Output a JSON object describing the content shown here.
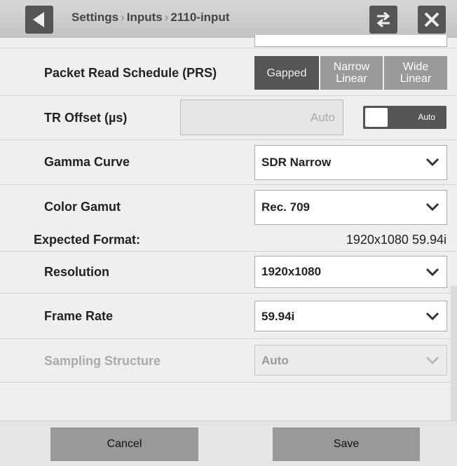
{
  "header": {
    "crumb1": "Settings",
    "crumb2": "Inputs",
    "crumb3": "2110-input",
    "sep": "›",
    "back_icon": "back-arrow-icon",
    "swap_icon": "swap-arrows-icon",
    "close_icon": "close-x-icon"
  },
  "prs": {
    "label": "Packet Read Schedule (PRS)",
    "options": [
      {
        "line1": "Gapped",
        "line2": "",
        "selected": true
      },
      {
        "line1": "Narrow",
        "line2": "Linear",
        "selected": false
      },
      {
        "line1": "Wide",
        "line2": "Linear",
        "selected": false
      }
    ]
  },
  "tr_offset": {
    "label": "TR Offset (µs)",
    "value": "Auto",
    "toggle_label": "Auto"
  },
  "gamma": {
    "label": "Gamma Curve",
    "value": "SDR Narrow"
  },
  "gamut": {
    "label": "Color Gamut",
    "value": "Rec. 709"
  },
  "expected": {
    "label": "Expected Format:",
    "value": "1920x1080 59.94i"
  },
  "resolution": {
    "label": "Resolution",
    "value": "1920x1080"
  },
  "frame_rate": {
    "label": "Frame Rate",
    "value": "59.94i"
  },
  "sampling": {
    "label": "Sampling Structure",
    "value": "Auto"
  },
  "footer": {
    "cancel": "Cancel",
    "save": "Save"
  },
  "colors": {
    "selected_btn": "#555555",
    "btn": "#9a9a9a",
    "header": "#cccccc"
  }
}
